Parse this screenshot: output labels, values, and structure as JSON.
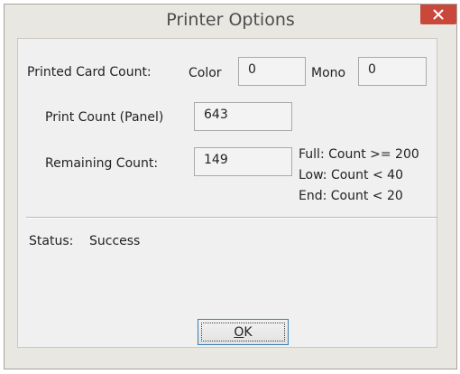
{
  "window": {
    "title": "Printer Options"
  },
  "printed_card_count": {
    "label": "Printed Card Count:",
    "color_label": "Color",
    "color_value": "0",
    "mono_label": "Mono",
    "mono_value": "0"
  },
  "print_count": {
    "label": "Print Count (Panel)",
    "value": "643"
  },
  "remaining_count": {
    "label": "Remaining Count:",
    "value": "149"
  },
  "thresholds": {
    "full": "Full: Count >= 200",
    "low": "Low: Count < 40",
    "end": "End: Count < 20"
  },
  "status": {
    "label": "Status:",
    "value": "Success"
  },
  "ok_button": {
    "mnemonic": "O",
    "rest": "K"
  },
  "colors": {
    "close_button": "#c9483b",
    "window_bg": "#e9e7e1",
    "focus_border": "#3c7fb1"
  },
  "icons": {
    "close": "close-icon"
  }
}
